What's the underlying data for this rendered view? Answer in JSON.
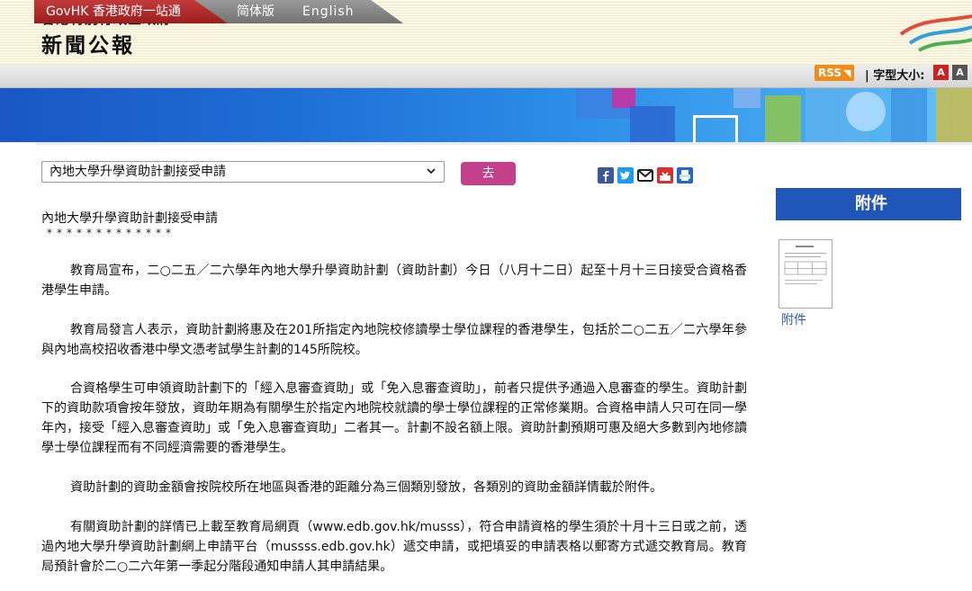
{
  "header": {
    "agency": "香港特別行政區政府",
    "title": "新聞公報"
  },
  "nav": {
    "govhk": "GovHK 香港政府一站通",
    "simplified": "简体版",
    "english": "English",
    "rss": "RSS",
    "font_size_label": "| 字型大小:",
    "font_small": "A",
    "font_large": "A"
  },
  "selector": {
    "selected": "內地大學升學資助計劃接受申請",
    "go": "去"
  },
  "share_icons": [
    "facebook-icon",
    "twitter-icon",
    "email-icon",
    "download-icon",
    "print-icon"
  ],
  "article": {
    "headline": "內地大學升學資助計劃接受申請",
    "stars": "*************",
    "paragraphs": [
      "教育局宣布，二○二五／二六學年內地大學升學資助計劃（資助計劃）今日（八月十二日）起至十月十三日接受合資格香港學生申請。",
      "教育局發言人表示，資助計劃將惠及在201所指定內地院校修讀學士學位課程的香港學生，包括於二○二五／二六學年參與內地高校招收香港中學文憑考試學生計劃的145所院校。",
      "合資格學生可申領資助計劃下的「經入息審查資助」或「免入息審查資助」，前者只提供予通過入息審查的學生。資助計劃下的資助款項會按年發放，資助年期為有關學生於指定內地院校就讀的學士學位課程的正常修業期。合資格申請人只可在同一學年內，接受「經入息審查資助」或「免入息審查資助」二者其一。計劃不設名額上限。資助計劃預期可惠及絕大多數到內地修讀學士學位課程而有不同經濟需要的香港學生。",
      "資助計劃的資助金額會按院校所在地區與香港的距離分為三個類別發放，各類別的資助金額詳情載於附件。"
    ],
    "para5": {
      "part1": "有關資助計劃的詳情已上載至教育局網頁（",
      "link1": "www.edb.gov.hk/musss",
      "part2": "），符合申請資格的學生須於十月十三日或之前，透過內地大學升學資助計劃網上申請平台（",
      "link2": "mussss.edb.gov.hk",
      "part3": "）遞交申請，或把填妥的申請表格以郵寄方式遞交教育局。教育局預計會於二○二六年第一季起分階段通知申請人其申請結果。"
    }
  },
  "attachments": {
    "header": "附件",
    "link": "附件"
  },
  "colors": {
    "accent_red": "#b02a2a",
    "go_button": "#c2418a",
    "attach_header": "#1f56b8",
    "banner_blue": "#1e6ed6"
  }
}
